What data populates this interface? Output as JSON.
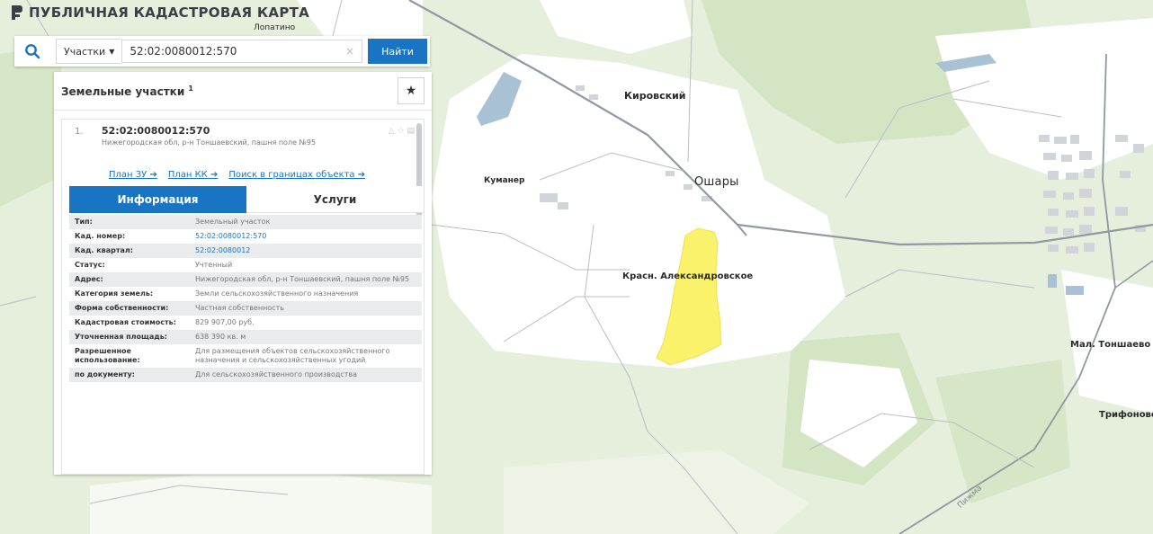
{
  "app": {
    "title": "ПУБЛИЧНАЯ КАДАСТРОВАЯ КАРТА"
  },
  "search": {
    "type_label": "Участки",
    "value": "52:02:0080012:570",
    "clear_icon": "×",
    "button_label": "Найти"
  },
  "panel": {
    "title": "Земельные участки",
    "count": "1",
    "result": {
      "index": "1.",
      "number": "52:02:0080012:570",
      "address": "Нижегородская обл, р-н Тоншаевский, пашня поле №95",
      "links": [
        "План ЗУ ➔",
        "План КК ➔",
        "Поиск в границах объекта ➔"
      ],
      "tabs": [
        "Информация",
        "Услуги"
      ],
      "info": [
        {
          "key": "Тип:",
          "value": "Земельный участок"
        },
        {
          "key": "Кад. номер:",
          "value": "52:02:0080012:570"
        },
        {
          "key": "Кад. квартал:",
          "value": "52:02:0080012"
        },
        {
          "key": "Статус:",
          "value": "Учтенный"
        },
        {
          "key": "Адрес:",
          "value": "Нижегородская обл, р-н Тоншаевский, пашня поле №95"
        },
        {
          "key": "Категория земель:",
          "value": "Земли сельскохозяйственного назначения"
        },
        {
          "key": "Форма собственности:",
          "value": "Частная собственность"
        },
        {
          "key": "Кадастровая стоимость:",
          "value": "829 907,00 руб."
        },
        {
          "key": "Уточненная площадь:",
          "value": "638 390 кв. м"
        },
        {
          "key": "Разрешенное использование:",
          "value": "Для размещения объектов сельскохозяйственного назначения и сельскохозяйственных угодий"
        },
        {
          "key": "по документу:",
          "value": "Для сельскохозяйственного производства"
        }
      ]
    }
  },
  "map": {
    "labels": {
      "lopatino": "Лопатино",
      "kirovsky": "Кировский",
      "kumaner": "Куманер",
      "oshary": "Ошары",
      "krasn": "Красн. Александровское",
      "mal_tonshaevo": "Мал. Тоншаево",
      "trifonovo": "Трифоново",
      "road": "Пижма"
    },
    "colors": {
      "parcel": "#fbf26b",
      "forest": "#d7e6c6",
      "clearing": "#ffffff",
      "water": "#a9c1d4",
      "road": "#8f98a3"
    }
  }
}
